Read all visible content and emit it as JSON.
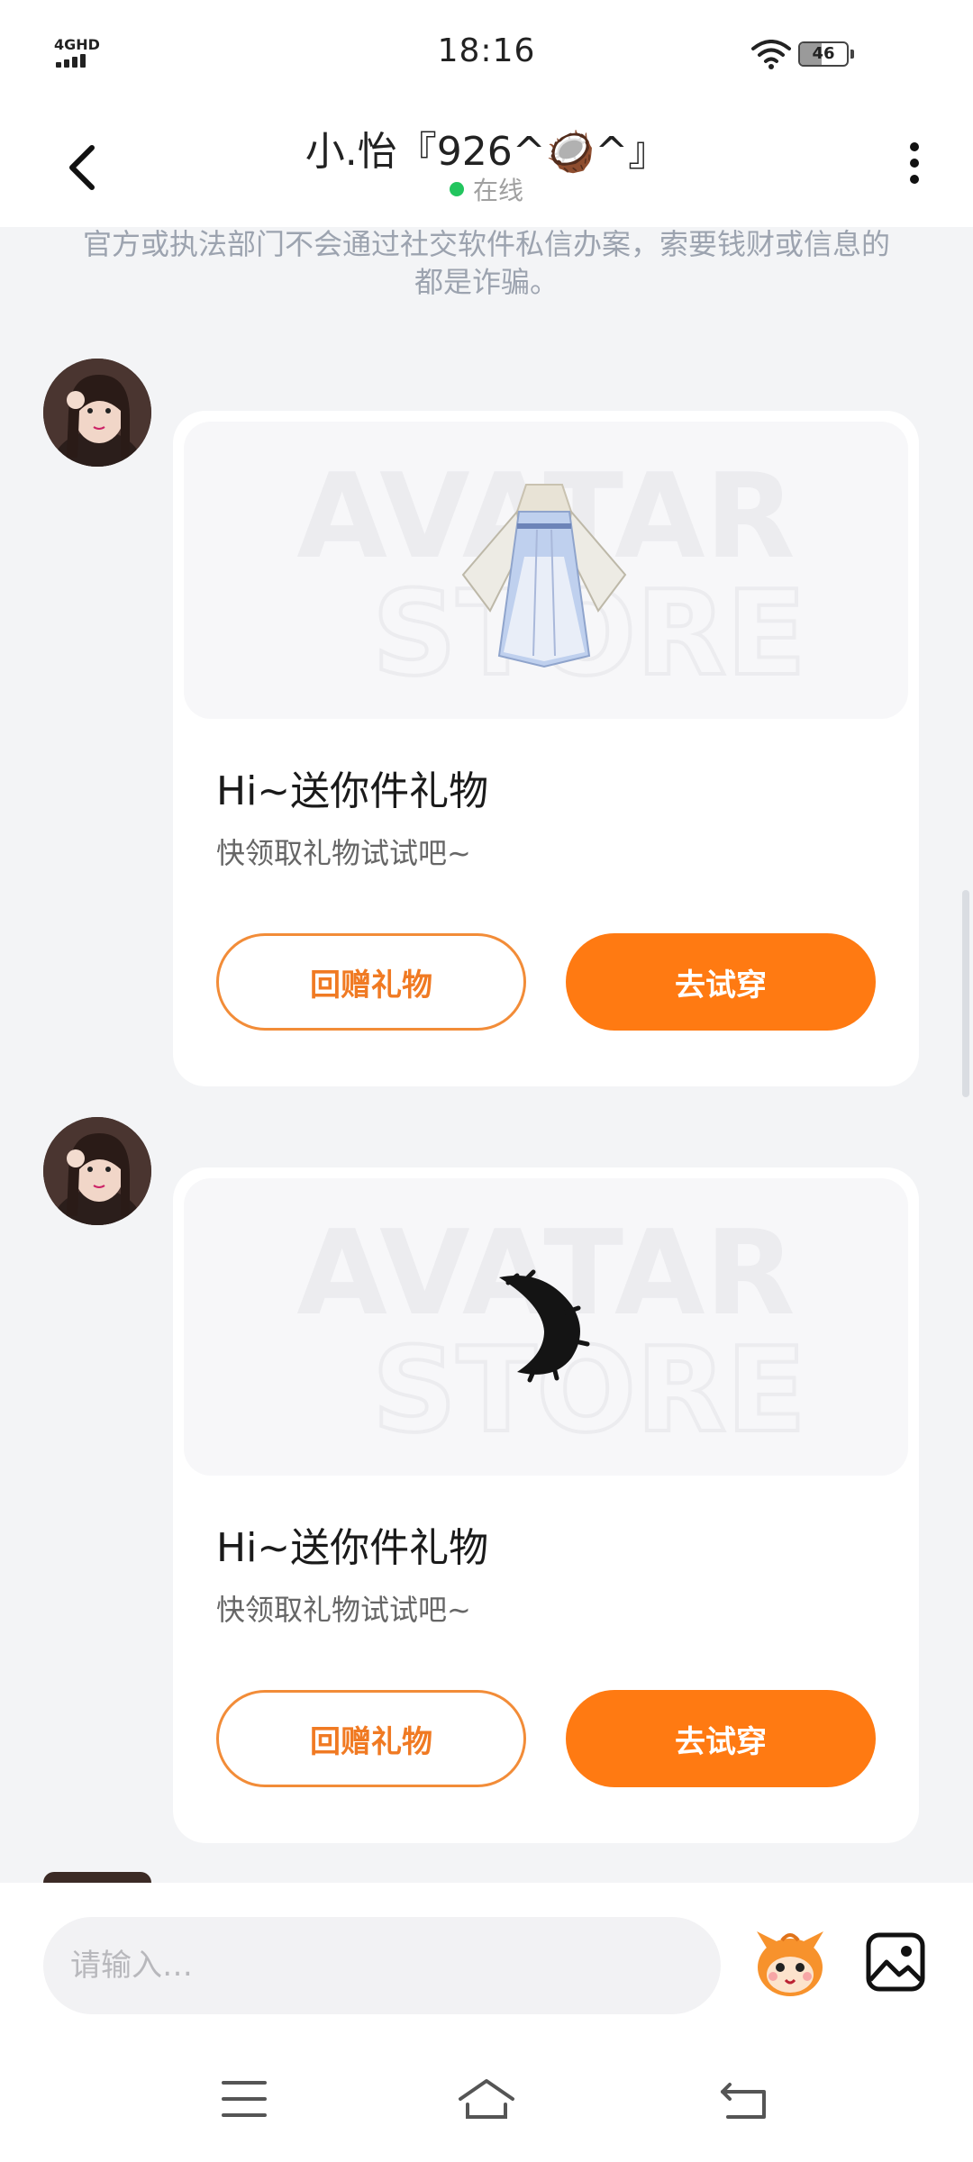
{
  "status_bar": {
    "time": "18:16",
    "network": "4GHD",
    "battery": "46"
  },
  "header": {
    "contact_name": "小.怡『926^🥥^』",
    "status": "在线"
  },
  "notice": "官方或执法部门不会通过社交软件私信办案，索要钱财或信息的都是诈骗。",
  "messages": [
    {
      "title": "Hi~送你件礼物",
      "subtitle": "快领取礼物试试吧~",
      "return_gift_label": "回赠礼物",
      "try_on_label": "去试穿",
      "item_icon": "hanfu-dress-icon"
    },
    {
      "title": "Hi~送你件礼物",
      "subtitle": "快领取礼物试试吧~",
      "return_gift_label": "回赠礼物",
      "try_on_label": "去试穿",
      "item_icon": "fur-tail-icon"
    }
  ],
  "input": {
    "placeholder": "请输入…"
  },
  "colors": {
    "accent": "#FF7A12",
    "online": "#22C55E",
    "background": "#F3F4F6"
  }
}
